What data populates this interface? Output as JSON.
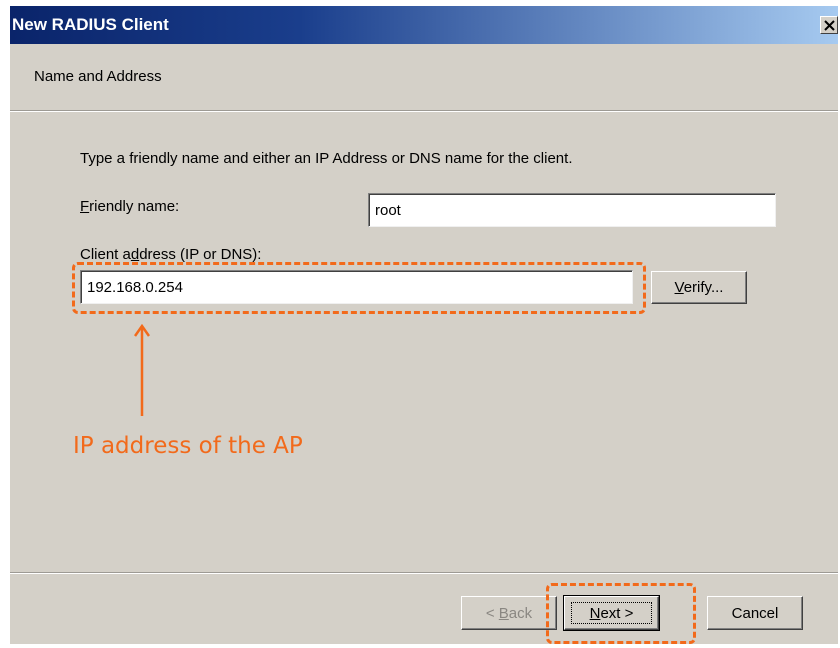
{
  "window": {
    "title": "New RADIUS Client",
    "close_glyph": "✕"
  },
  "header": {
    "section_label": "Name and Address"
  },
  "form": {
    "instruction": "Type a friendly name and either an IP Address or DNS name for the client.",
    "friendly_name_label": "Friendly name:",
    "friendly_name_value": "root",
    "client_address_label": "Client address (IP or DNS):",
    "client_address_value": "192.168.0.254",
    "verify_label": "Verify..."
  },
  "buttons": {
    "back_label": "< Back",
    "next_label": "Next >",
    "cancel_label": "Cancel"
  },
  "annotations": {
    "ip_callout_text": "IP address of the AP",
    "accent_color": "#f26a1b"
  },
  "icons": {
    "close": "close-icon",
    "arrow": "arrow-up-icon"
  }
}
